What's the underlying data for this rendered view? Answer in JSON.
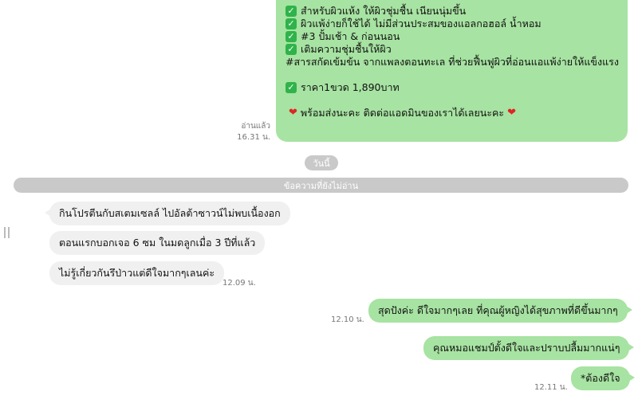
{
  "top_message": {
    "lines": [
      {
        "check": true,
        "text": "สำหรับผิวแห้ง ให้ผิวชุ่มชื้น เนียนนุ่มขึ้น"
      },
      {
        "check": true,
        "text": "ผิวแพ้ง่ายก็ใช้ได้ ไม่มีส่วนประสมของแอลกอฮอล์ น้ำหอม"
      },
      {
        "check": true,
        "text": "#3 ปั้มเช้า & ก่อนนอน"
      },
      {
        "check": true,
        "text": "เติมความชุ่มชื้นให้ผิว"
      },
      {
        "check": false,
        "text": "#สารสกัดเข้มข้น จากแพลงตอนทะเล ที่ช่วยฟื้นฟูผิวที่อ่อนแอแพ้ง่ายให้แข็งแรง"
      }
    ],
    "price": "ราคา1ขวด 1,890บาท",
    "closing": "พร้อมส่งนะคะ ติดต่อแอดมินของเราได้เลยนะคะ",
    "read_label": "อ่านแล้ว",
    "time": "16.31 น."
  },
  "date_pill": "วันนี้",
  "unread_bar": "ข้อความที่ยังไม่อ่าน",
  "incoming": [
    {
      "text": "กินโปรตีนกับสเตมเซลล์ ไปอัลต้าซาวน์ไม่พบเนื้องอก"
    },
    {
      "text": "ตอนแรกบอกเจอ 6 ซม ในมดลูกเมื่อ 3 ปีที่แล้ว"
    },
    {
      "text": "ไม่รู้เกี่ยวกันรึป่าวแต่ดีใจมากๆเลนค่ะ",
      "time": "12.09 น."
    }
  ],
  "outgoing": [
    {
      "text": "สุดปังค่ะ  ดีใจมากๆเลย ที่คุณผู้หญิงได้สุขภาพที่ดีขึ้นมากๆ",
      "time": "12.10 น."
    },
    {
      "text": "คุณหมอแชมป์ตั้งดีใจและปราบปลื้มมากแน่ๆ"
    },
    {
      "text": "*ต้องดีใจ",
      "time": "12.11 น."
    }
  ],
  "colors": {
    "outgoing_bubble": "#a7e3a2",
    "incoming_bubble": "#f0f0f0",
    "check": "#2fb34a",
    "heart": "#e02424"
  },
  "icons": {
    "check": "check-box-icon",
    "heart": "heart-icon"
  }
}
